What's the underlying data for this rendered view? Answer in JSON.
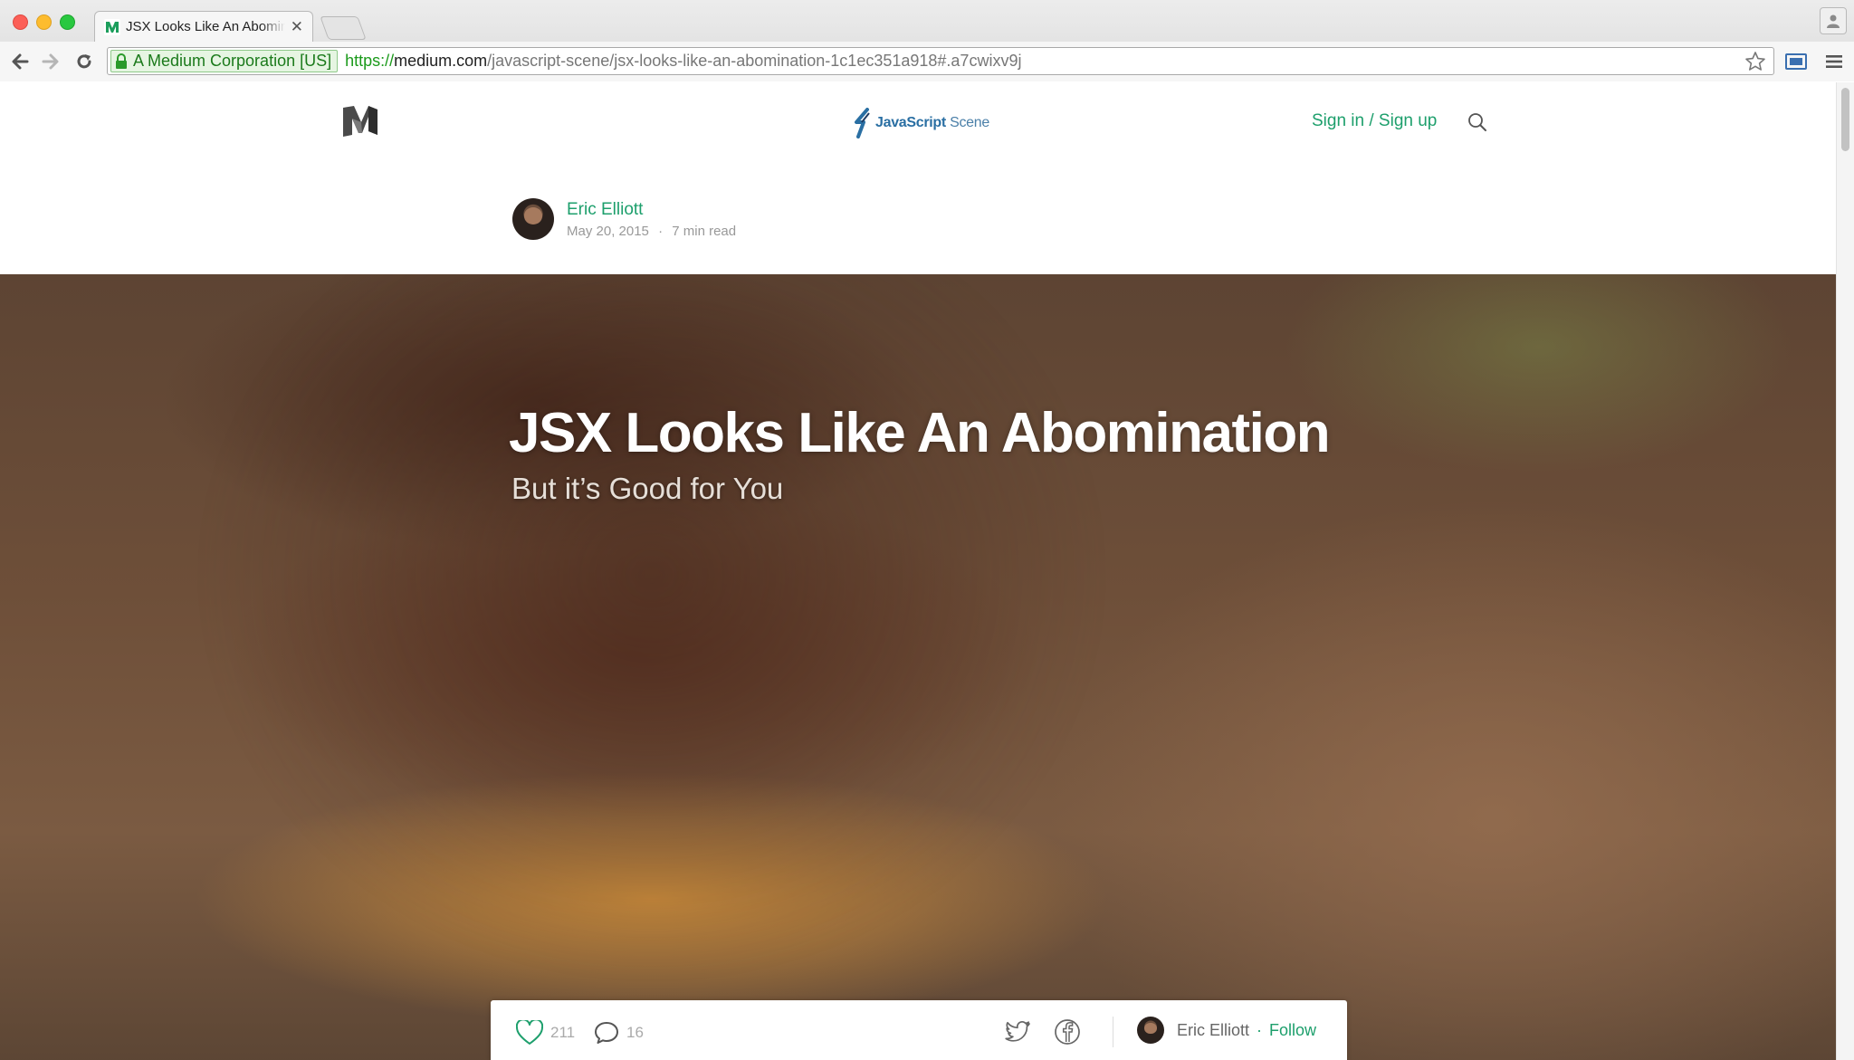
{
  "browser": {
    "tab_title": "JSX Looks Like An Abomination",
    "ev_label": "A Medium Corporation [US]",
    "url_scheme": "https://",
    "url_host": "medium.com",
    "url_path": "/javascript-scene/jsx-looks-like-an-abomination-1c1ec351a918#.a7cwixv9j"
  },
  "header": {
    "publication_name_bold": "JavaScript",
    "publication_name_light": " Scene",
    "signin_label": "Sign in / Sign up"
  },
  "byline": {
    "author": "Eric Elliott",
    "date": "May 20, 2015",
    "separator": "·",
    "read_time": "7 min read"
  },
  "hero": {
    "title": "JSX Looks Like An Abomination",
    "subtitle": "But it’s Good for You"
  },
  "actionbar": {
    "recommend_count": "211",
    "response_count": "16",
    "author": "Eric Elliott",
    "separator": "·",
    "follow_label": "Follow"
  },
  "colors": {
    "accent": "#1d9f6c",
    "ev_green": "#1b7a1b"
  }
}
